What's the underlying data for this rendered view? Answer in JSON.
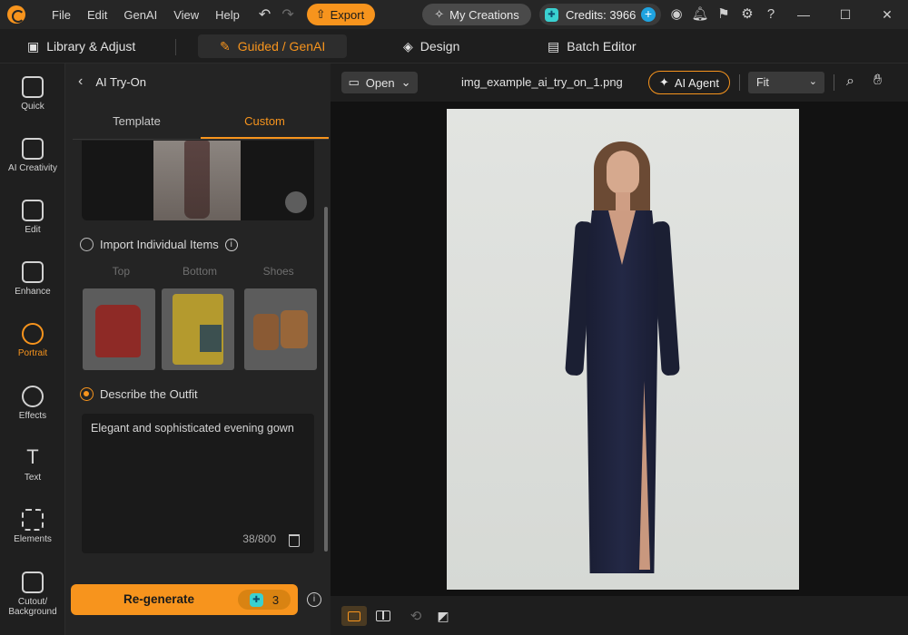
{
  "titlebar": {
    "menu": [
      "File",
      "Edit",
      "GenAI",
      "View",
      "Help"
    ],
    "export_label": "Export",
    "my_creations_label": "My Creations",
    "credits_label": "Credits: 3966"
  },
  "modes": {
    "library": "Library & Adjust",
    "guided": "Guided / GenAI",
    "design": "Design",
    "batch": "Batch Editor"
  },
  "rail": {
    "quick": "Quick",
    "ai_creativity": "AI Creativity",
    "edit": "Edit",
    "enhance": "Enhance",
    "portrait": "Portrait",
    "effects": "Effects",
    "text": "Text",
    "elements": "Elements",
    "cutout_line1": "Cutout/",
    "cutout_line2": "Background"
  },
  "panel": {
    "title": "AI Try-On",
    "tabs": {
      "template": "Template",
      "custom": "Custom"
    },
    "import_label": "Import Individual Items",
    "item_labels": {
      "top": "Top",
      "bottom": "Bottom",
      "shoes": "Shoes"
    },
    "describe_label": "Describe the Outfit",
    "description": "Elegant and sophisticated evening gown",
    "char_count": "38/800",
    "regenerate_label": "Re-generate",
    "regenerate_cost": "3"
  },
  "canvas": {
    "open_label": "Open",
    "filename": "img_example_ai_try_on_1.png",
    "ai_agent_label": "AI Agent",
    "zoom_value": "Fit"
  },
  "colors": {
    "accent": "#f7941d",
    "credit_gem": "#3ad0d0"
  }
}
